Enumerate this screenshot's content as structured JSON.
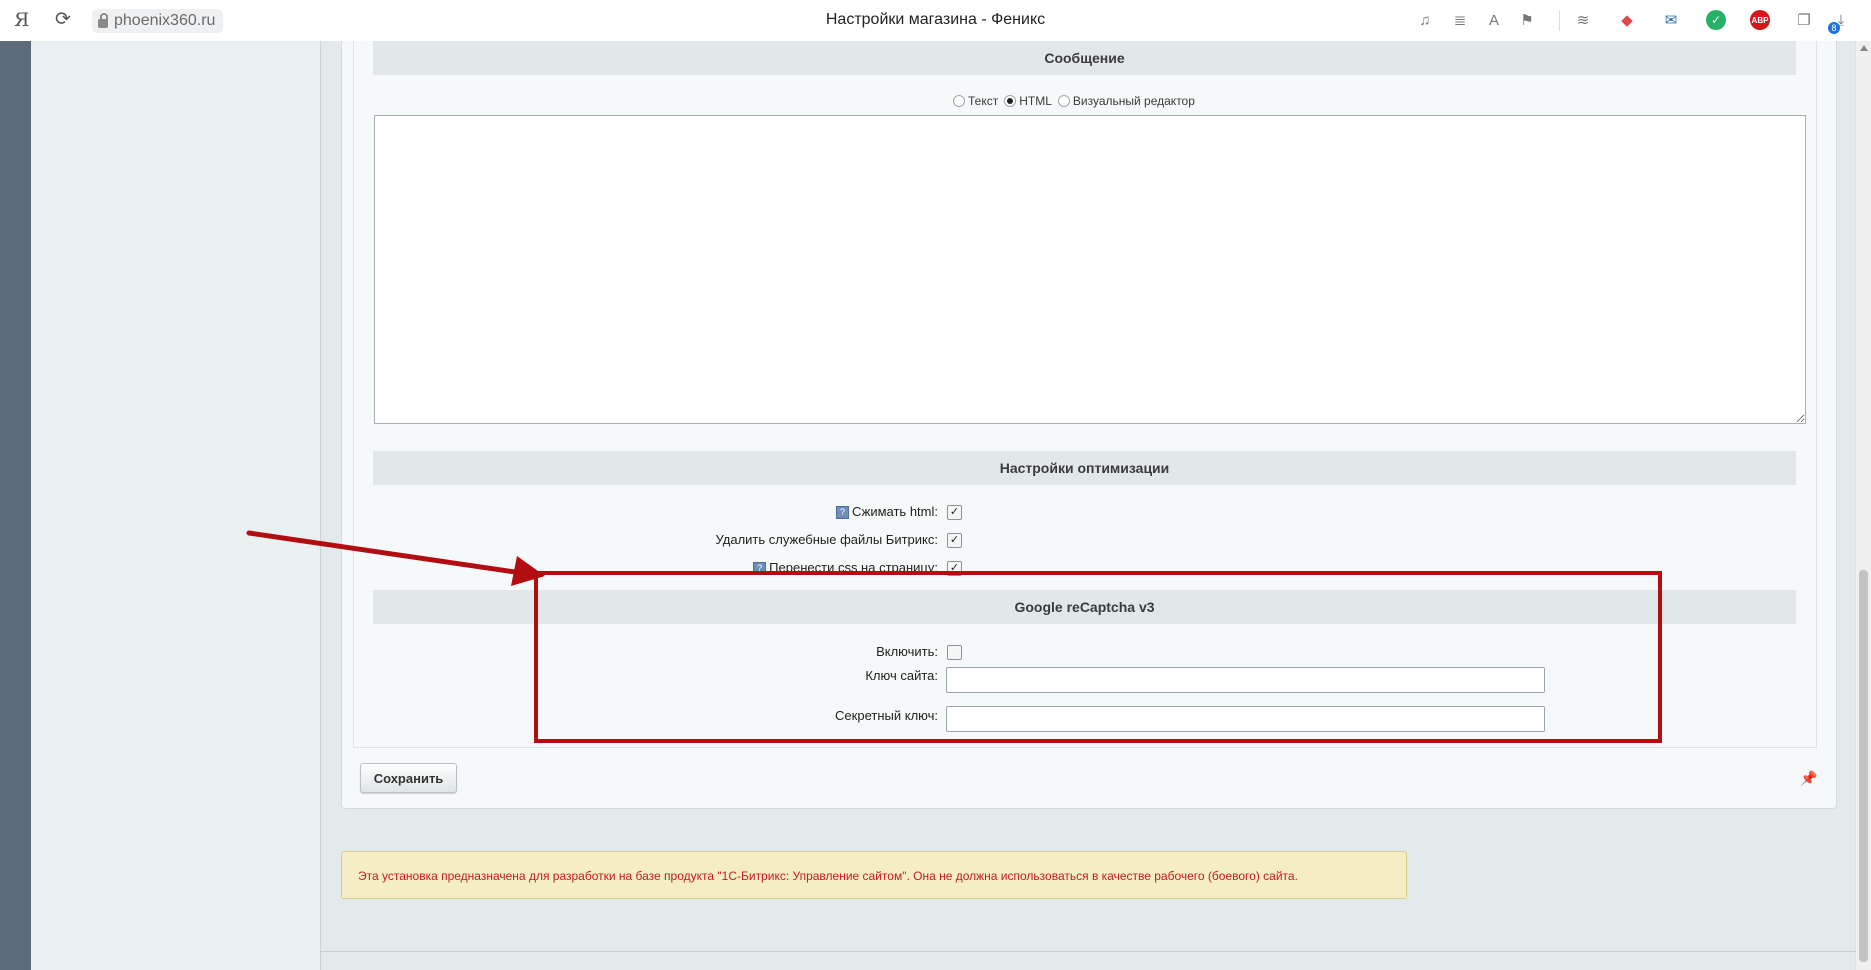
{
  "browser": {
    "logo": "Я",
    "url": "phoenix360.ru",
    "tab_title": "Настройки магазина - Феникс",
    "extensions": [
      "headphones-icon",
      "reader-icon",
      "translate-icon",
      "bookmark-icon",
      "layers-icon",
      "video-icon",
      "mail-icon",
      "green-ext-icon",
      "adblock-icon",
      "collections-icon",
      "downloads-icon"
    ],
    "abp_label": "ABP",
    "downloads_badge": "8"
  },
  "message_section": {
    "heading": "Сообщение",
    "format_options": [
      "Текст",
      "HTML",
      "Визуальный редактор"
    ],
    "selected_format": "HTML",
    "body": ""
  },
  "optimization": {
    "heading": "Настройки оптимизации",
    "fields": [
      {
        "label": "Сжимать html:",
        "help": true,
        "checked": true
      },
      {
        "label": "Удалить служебные файлы Битрикс:",
        "help": false,
        "checked": true
      },
      {
        "label": "Перенести css на страницу:",
        "help": true,
        "checked": true
      }
    ]
  },
  "recaptcha": {
    "heading": "Google reCaptcha v3",
    "enable_label": "Включить:",
    "enable_checked": false,
    "site_key_label": "Ключ сайта:",
    "site_key_value": "",
    "secret_key_label": "Секретный ключ:",
    "secret_key_value": ""
  },
  "save_label": "Сохранить",
  "notice": "Эта установка предназначена для разработки на базе продукта \"1С-Битрикс: Управление сайтом\". Она не должна использоваться в качестве рабочего (боевого) сайта.",
  "colors": {
    "annotation": "#b20e12",
    "notice_text": "#c8191d",
    "notice_bg": "#f5eec5",
    "section_header_bg": "#e0e8ea"
  }
}
